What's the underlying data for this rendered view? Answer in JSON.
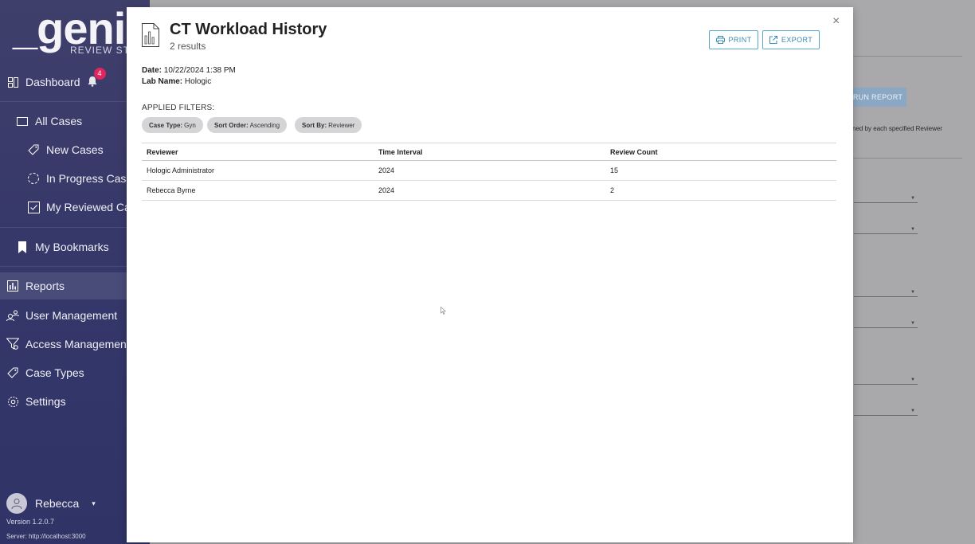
{
  "sidebar": {
    "logo_main": "_genius",
    "logo_sub": "REVIEW STATIO",
    "notifications_count": "4",
    "items": [
      {
        "label": "Dashboard"
      },
      {
        "label": "All Cases"
      },
      {
        "label": "New Cases"
      },
      {
        "label": "In Progress Cases"
      },
      {
        "label": "My Reviewed Cases"
      },
      {
        "label": "My Bookmarks"
      },
      {
        "label": "Reports"
      },
      {
        "label": "User Management"
      },
      {
        "label": "Access Management"
      },
      {
        "label": "Case Types"
      },
      {
        "label": "Settings"
      }
    ],
    "user_name": "Rebecca",
    "version": "Version 1.2.0.7",
    "server": "Server: http://localhost:3000"
  },
  "background": {
    "run_report": "RUN REPORT",
    "description": "ned by each specified Reviewer"
  },
  "modal": {
    "title": "CT Workload History",
    "subtitle": "2 results",
    "print_label": "PRINT",
    "export_label": "EXPORT",
    "close_symbol": "×",
    "date_label": "Date:",
    "date_value": "10/22/2024 1:38 PM",
    "lab_label": "Lab Name:",
    "lab_value": "Hologic",
    "filters_title": "APPLIED FILTERS:",
    "filters": [
      {
        "key": "Case Type:",
        "value": "Gyn"
      },
      {
        "key": "Sort Order:",
        "value": "Ascending"
      },
      {
        "key": "Sort By:",
        "value": "Reviewer"
      }
    ],
    "table": {
      "headers": [
        "Reviewer",
        "Time Interval",
        "Review Count"
      ],
      "rows": [
        [
          "Hologic Administrator",
          "2024",
          "15"
        ],
        [
          "Rebecca Byrne",
          "2024",
          "2"
        ]
      ]
    }
  },
  "colors": {
    "sidebar": "#36386a",
    "accent": "#3a8bb0",
    "badge": "#e0245e"
  }
}
